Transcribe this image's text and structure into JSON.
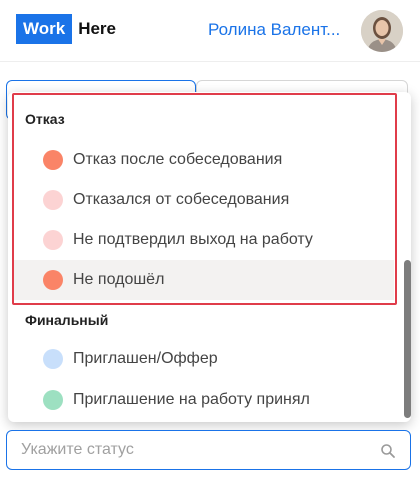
{
  "header": {
    "logo_work": "Work",
    "logo_here": "Here",
    "user_name": "Ролина Валент..."
  },
  "dropdown": {
    "groups": [
      {
        "title": "Отказ",
        "options": [
          {
            "label": "Отказ после собеседования",
            "color": "#fa8467"
          },
          {
            "label": "Отказался от собеседования",
            "color": "#fcd3d3"
          },
          {
            "label": "Не подтвердил выход на работу",
            "color": "#fcd3d3"
          },
          {
            "label": "Не подошёл",
            "color": "#fa8467"
          }
        ]
      },
      {
        "title": "Финальный",
        "options": [
          {
            "label": "Приглашен/Оффер",
            "color": "#c8dffb"
          },
          {
            "label": "Приглашение на работу принял",
            "color": "#9de0c1"
          }
        ]
      }
    ]
  },
  "status_input": {
    "placeholder": "Укажите статус"
  },
  "colors": {
    "accent": "#1a73e8",
    "highlight_border": "#e03c4a"
  }
}
